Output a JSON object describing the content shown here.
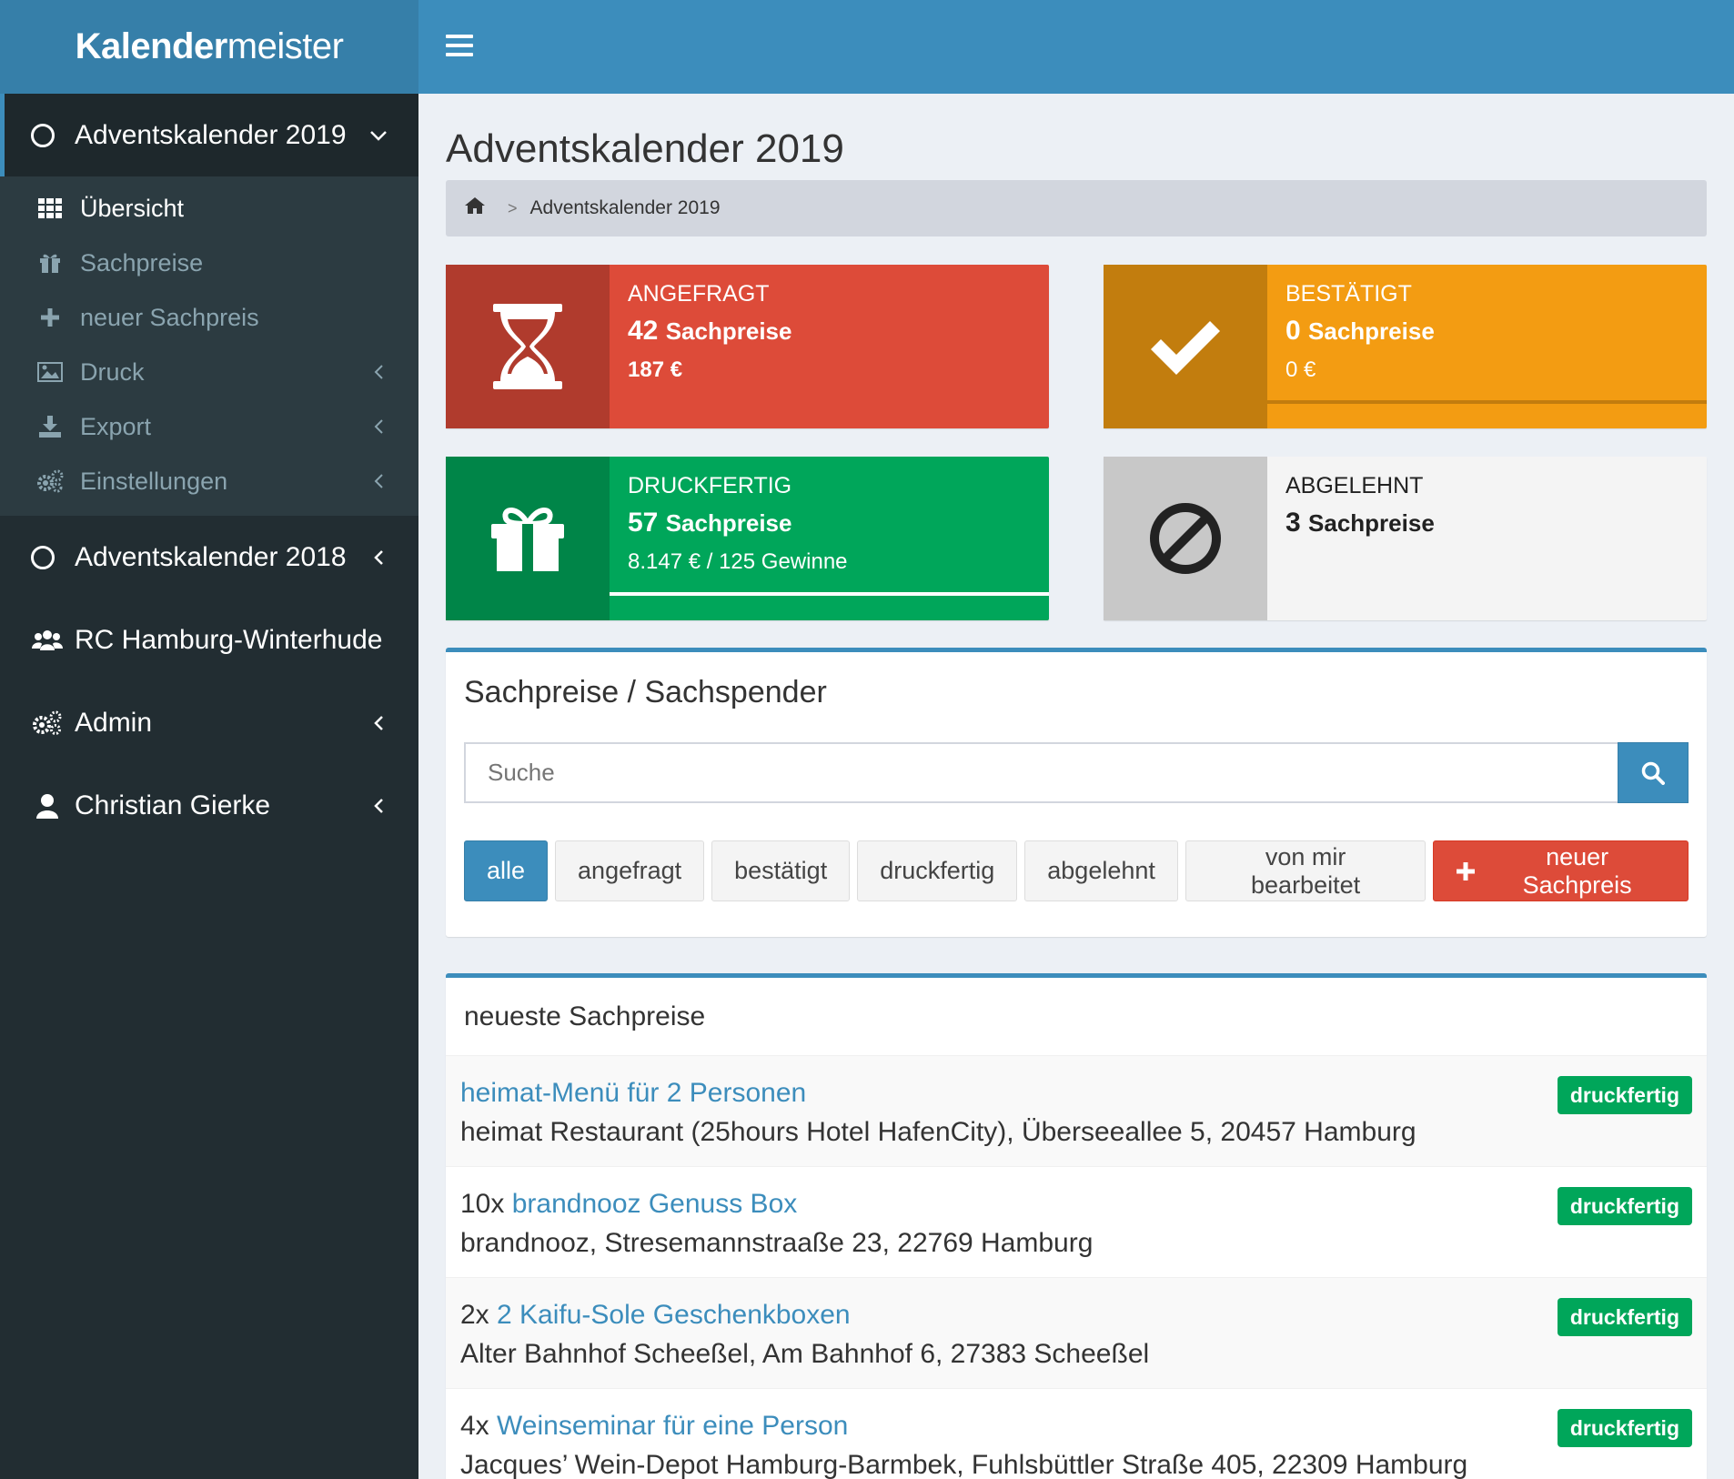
{
  "logo": {
    "bold": "Kalender",
    "thin": "meister"
  },
  "sidebar": {
    "calendar_2019": {
      "label": "Adventskalender 2019"
    },
    "submenu": [
      {
        "label": "Übersicht",
        "icon": "grid-icon"
      },
      {
        "label": "Sachpreise",
        "icon": "gift-icon"
      },
      {
        "label": "neuer Sachpreis",
        "icon": "plus-icon"
      },
      {
        "label": "Druck",
        "icon": "image-icon"
      },
      {
        "label": "Export",
        "icon": "download-icon"
      },
      {
        "label": "Einstellungen",
        "icon": "cogs-icon"
      }
    ],
    "calendar_2018": {
      "label": "Adventskalender 2018"
    },
    "club": {
      "label": "RC Hamburg-Winterhude"
    },
    "admin": {
      "label": "Admin"
    },
    "user": {
      "label": "Christian Gierke"
    }
  },
  "page": {
    "title": "Adventskalender 2019",
    "breadcrumb": {
      "sep": ">",
      "current": "Adventskalender 2019"
    }
  },
  "stats": {
    "requested": {
      "title": "ANGEFRAGT",
      "count": "42",
      "unit": "Sachpreise",
      "sub": "187 €"
    },
    "confirmed": {
      "title": "BESTÄTIGT",
      "count": "0",
      "unit": "Sachpreise",
      "sub": "0 €",
      "progress": 0
    },
    "printready": {
      "title": "DRUCKFERTIG",
      "count": "57",
      "unit": "Sachpreise",
      "sub": "8.147 € / 125 Gewinne",
      "progress": 100
    },
    "rejected": {
      "title": "ABGELEHNT",
      "count": "3",
      "unit": "Sachpreise"
    }
  },
  "search_panel": {
    "title": "Sachpreise / Sachspender",
    "search_placeholder": "Suche",
    "filters": [
      "alle",
      "angefragt",
      "bestätigt",
      "druckfertig",
      "abgelehnt",
      "von mir bearbeitet"
    ],
    "new_button": "neuer Sachpreis"
  },
  "latest": {
    "title": "neueste Sachpreise",
    "items": [
      {
        "qty": "",
        "name": "heimat-Menü für 2 Personen",
        "donor": "heimat Restaurant (25hours Hotel HafenCity), Überseeallee 5, 20457 Hamburg",
        "status": "druckfertig"
      },
      {
        "qty": "10x ",
        "name": "brandnooz Genuss Box",
        "donor": "brandnooz, Stresemannstraaße 23, 22769 Hamburg",
        "status": "druckfertig"
      },
      {
        "qty": "2x ",
        "name": "2 Kaifu-Sole Geschenkboxen",
        "donor": "Alter Bahnhof Scheeßel, Am Bahnhof 6, 27383 Scheeßel",
        "status": "druckfertig"
      },
      {
        "qty": "4x ",
        "name": "Weinseminar für eine Person",
        "donor": "Jacques’ Wein-Depot Hamburg-Barmbek, Fuhlsbüttler Straße 405, 22309 Hamburg",
        "status": "druckfertig"
      }
    ]
  },
  "colors": {
    "primary": "#3c8dbc",
    "danger": "#dd4b39",
    "warning": "#f39c12",
    "success": "#00a65a",
    "sidebar": "#222d32"
  }
}
